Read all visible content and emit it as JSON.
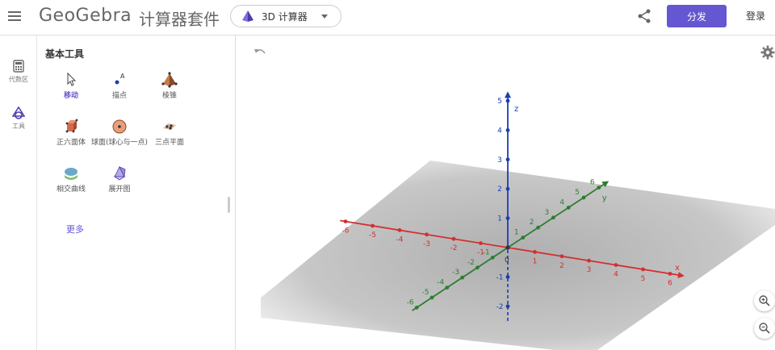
{
  "header": {
    "logo": "GeoGebra",
    "suite_title": "计算器套件",
    "calculator_select": "3D 计算器",
    "share_label": "分发",
    "login_label": "登录"
  },
  "leftnav": {
    "items": [
      {
        "label": "代数区"
      },
      {
        "label": "工具"
      }
    ]
  },
  "tools": {
    "title": "基本工具",
    "items": [
      {
        "label": "移动"
      },
      {
        "label": "描点"
      },
      {
        "label": "棱锥"
      },
      {
        "label": "正六面体"
      },
      {
        "label": "球面(球心与一点)"
      },
      {
        "label": "三点平面"
      },
      {
        "label": "相交曲线"
      },
      {
        "label": "展开图"
      }
    ],
    "more_label": "更多"
  },
  "graphics": {
    "axes": {
      "x_label": "x",
      "y_label": "y",
      "z_label": "z",
      "x_ticks": [
        "-6",
        "-5",
        "-4",
        "-3",
        "-2",
        "-1",
        "1",
        "2",
        "3",
        "4",
        "5",
        "6"
      ],
      "y_ticks": [
        "-6",
        "-5",
        "-4",
        "-3",
        "-2",
        "-1",
        "1",
        "2",
        "3",
        "4",
        "5",
        "6"
      ],
      "z_ticks": [
        "-2",
        "-1",
        "1",
        "2",
        "3",
        "4",
        "5"
      ],
      "origin": "0"
    },
    "colors": {
      "x_axis": "#d32f2f",
      "y_axis": "#2e7d32",
      "z_axis": "#1a3fb0",
      "accent": "#6557d2"
    }
  }
}
